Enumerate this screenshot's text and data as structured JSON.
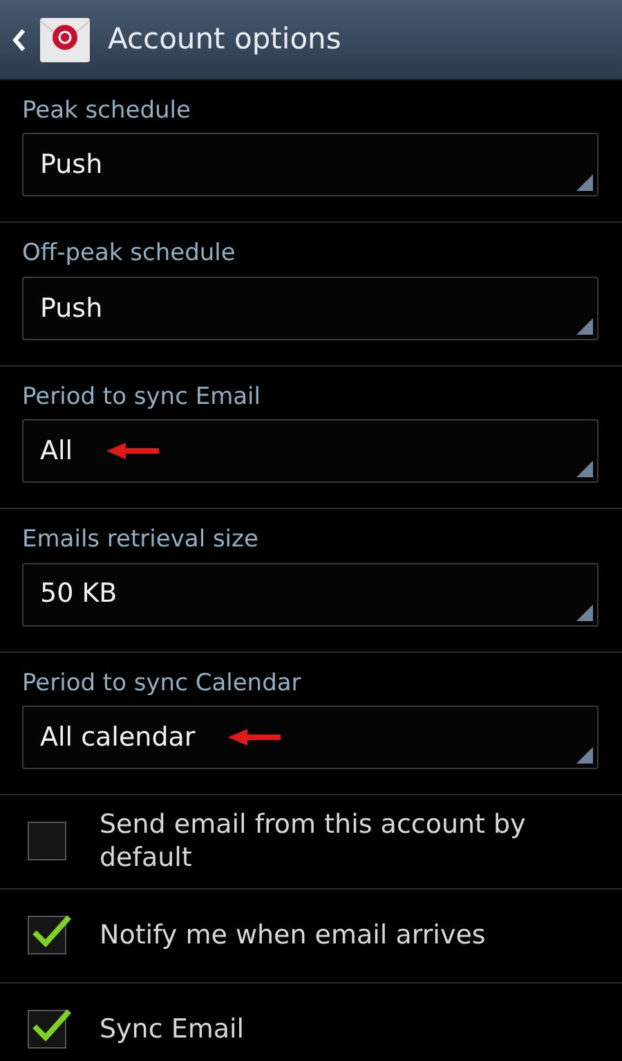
{
  "header": {
    "title": "Account options"
  },
  "dropdowns": [
    {
      "label": "Peak schedule",
      "value": "Push",
      "marked": false
    },
    {
      "label": "Off-peak schedule",
      "value": "Push",
      "marked": false
    },
    {
      "label": "Period to sync Email",
      "value": "All",
      "marked": true
    },
    {
      "label": "Emails retrieval size",
      "value": "50 KB",
      "marked": false
    },
    {
      "label": "Period to sync Calendar",
      "value": "All calendar",
      "marked": true
    }
  ],
  "checkboxes": [
    {
      "label": "Send email from this account by default",
      "checked": false
    },
    {
      "label": "Notify me when email arrives",
      "checked": true
    },
    {
      "label": "Sync Email",
      "checked": true
    }
  ]
}
